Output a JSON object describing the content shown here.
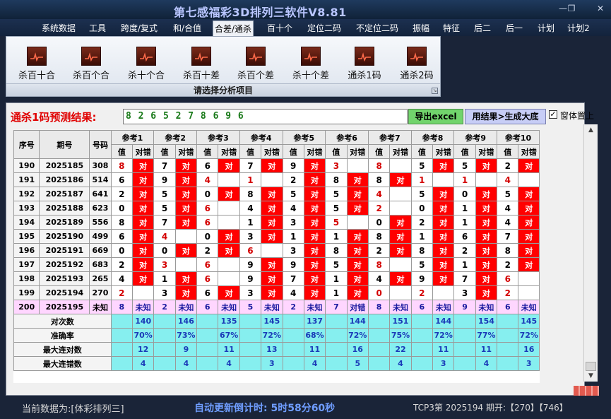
{
  "window": {
    "title": "第七感福彩3D排列三软件V8.81",
    "min": "—",
    "max": "❐",
    "close": "✕"
  },
  "menu": [
    "系统数据",
    "工具",
    "跨度/复式",
    "和/合值",
    "合差/通杀",
    "百十个",
    "定位二码",
    "不定位二码",
    "振幅",
    "特征",
    "后二",
    "后一",
    "计划",
    "计划2"
  ],
  "menu_active_index": 4,
  "ribbon": {
    "buttons": [
      "杀百十合",
      "杀百个合",
      "杀十个合",
      "杀百十差",
      "杀百个差",
      "杀十个差",
      "通杀1码",
      "通杀2码"
    ],
    "caption": "请选择分析项目",
    "launcher": "↘"
  },
  "prediction": {
    "label": "通杀1码预测结果:",
    "numbers": "8 2 6 5 2 7 8 6 9 6",
    "export_button": "导出excel",
    "generate_button": "用结果>生成大底",
    "checkbox_checked": true,
    "checkbox_label": "窗体置上"
  },
  "grid": {
    "fixed_headers": [
      "序号",
      "期号",
      "号码"
    ],
    "ref_headers": [
      "参考1",
      "参考2",
      "参考3",
      "参考4",
      "参考5",
      "参考6",
      "参考7",
      "参考8",
      "参考9",
      "参考10"
    ],
    "sub_headers": [
      "值",
      "对错"
    ],
    "right_mark": "对",
    "rows": [
      {
        "seq": "190",
        "period": "2025185",
        "number": "308",
        "refs": [
          [
            "8",
            1,
            1
          ],
          [
            "7",
            0,
            1
          ],
          [
            "6",
            0,
            1
          ],
          [
            "7",
            0,
            1
          ],
          [
            "9",
            0,
            1
          ],
          [
            "3",
            1,
            0
          ],
          [
            "8",
            1,
            0
          ],
          [
            "5",
            0,
            1
          ],
          [
            "5",
            0,
            1
          ],
          [
            "2",
            0,
            1
          ]
        ]
      },
      {
        "seq": "191",
        "period": "2025186",
        "number": "514",
        "refs": [
          [
            "6",
            0,
            1
          ],
          [
            "9",
            0,
            1
          ],
          [
            "4",
            1,
            0
          ],
          [
            "1",
            1,
            0
          ],
          [
            "2",
            0,
            1
          ],
          [
            "8",
            0,
            1
          ],
          [
            "8",
            0,
            1
          ],
          [
            "1",
            1,
            0
          ],
          [
            "1",
            1,
            0
          ],
          [
            "4",
            1,
            0
          ]
        ]
      },
      {
        "seq": "192",
        "period": "2025187",
        "number": "641",
        "refs": [
          [
            "2",
            0,
            1
          ],
          [
            "5",
            0,
            1
          ],
          [
            "0",
            0,
            1
          ],
          [
            "8",
            0,
            1
          ],
          [
            "5",
            0,
            1
          ],
          [
            "5",
            0,
            1
          ],
          [
            "4",
            1,
            0
          ],
          [
            "5",
            0,
            1
          ],
          [
            "0",
            0,
            1
          ],
          [
            "5",
            0,
            1
          ]
        ]
      },
      {
        "seq": "193",
        "period": "2025188",
        "number": "623",
        "refs": [
          [
            "0",
            0,
            1
          ],
          [
            "5",
            0,
            1
          ],
          [
            "6",
            1,
            0
          ],
          [
            "4",
            0,
            1
          ],
          [
            "4",
            0,
            1
          ],
          [
            "5",
            0,
            1
          ],
          [
            "2",
            1,
            0
          ],
          [
            "0",
            0,
            1
          ],
          [
            "1",
            0,
            1
          ],
          [
            "4",
            0,
            1
          ]
        ]
      },
      {
        "seq": "194",
        "period": "2025189",
        "number": "556",
        "refs": [
          [
            "8",
            0,
            1
          ],
          [
            "7",
            0,
            1
          ],
          [
            "6",
            1,
            0
          ],
          [
            "1",
            0,
            1
          ],
          [
            "3",
            0,
            1
          ],
          [
            "5",
            1,
            0
          ],
          [
            "0",
            0,
            1
          ],
          [
            "2",
            0,
            1
          ],
          [
            "1",
            0,
            1
          ],
          [
            "4",
            0,
            1
          ]
        ]
      },
      {
        "seq": "195",
        "period": "2025190",
        "number": "499",
        "refs": [
          [
            "6",
            0,
            1
          ],
          [
            "4",
            1,
            0
          ],
          [
            "0",
            0,
            1
          ],
          [
            "3",
            0,
            1
          ],
          [
            "1",
            0,
            1
          ],
          [
            "1",
            0,
            1
          ],
          [
            "8",
            0,
            1
          ],
          [
            "1",
            0,
            1
          ],
          [
            "6",
            0,
            1
          ],
          [
            "7",
            0,
            1
          ]
        ]
      },
      {
        "seq": "196",
        "period": "2025191",
        "number": "669",
        "refs": [
          [
            "0",
            0,
            1
          ],
          [
            "0",
            0,
            1
          ],
          [
            "2",
            0,
            1
          ],
          [
            "6",
            1,
            0
          ],
          [
            "3",
            0,
            1
          ],
          [
            "8",
            0,
            1
          ],
          [
            "2",
            0,
            1
          ],
          [
            "8",
            0,
            1
          ],
          [
            "2",
            0,
            1
          ],
          [
            "8",
            0,
            1
          ]
        ]
      },
      {
        "seq": "197",
        "period": "2025192",
        "number": "683",
        "refs": [
          [
            "2",
            0,
            1
          ],
          [
            "3",
            1,
            0
          ],
          [
            "6",
            1,
            0
          ],
          [
            "9",
            0,
            1
          ],
          [
            "9",
            0,
            1
          ],
          [
            "5",
            0,
            1
          ],
          [
            "8",
            1,
            0
          ],
          [
            "5",
            0,
            1
          ],
          [
            "1",
            0,
            1
          ],
          [
            "2",
            0,
            1
          ]
        ]
      },
      {
        "seq": "198",
        "period": "2025193",
        "number": "265",
        "refs": [
          [
            "4",
            0,
            1
          ],
          [
            "1",
            0,
            1
          ],
          [
            "6",
            1,
            0
          ],
          [
            "9",
            0,
            1
          ],
          [
            "7",
            0,
            1
          ],
          [
            "1",
            0,
            1
          ],
          [
            "4",
            0,
            1
          ],
          [
            "9",
            0,
            1
          ],
          [
            "7",
            0,
            1
          ],
          [
            "6",
            1,
            0
          ]
        ]
      },
      {
        "seq": "199",
        "period": "2025194",
        "number": "270",
        "refs": [
          [
            "2",
            1,
            0
          ],
          [
            "3",
            0,
            1
          ],
          [
            "6",
            0,
            1
          ],
          [
            "3",
            0,
            1
          ],
          [
            "4",
            0,
            1
          ],
          [
            "1",
            0,
            1
          ],
          [
            "0",
            1,
            0
          ],
          [
            "2",
            1,
            0
          ],
          [
            "3",
            0,
            1
          ],
          [
            "2",
            1,
            0
          ]
        ]
      }
    ],
    "pending": {
      "seq": "200",
      "period": "2025195",
      "number": "未知",
      "refs": [
        [
          "8",
          "未知"
        ],
        [
          "2",
          "未知"
        ],
        [
          "6",
          "未知"
        ],
        [
          "5",
          "未知"
        ],
        [
          "2",
          "未知"
        ],
        [
          "7",
          "对错"
        ],
        [
          "8",
          "未知"
        ],
        [
          "6",
          "未知"
        ],
        [
          "9",
          "未知"
        ],
        [
          "6",
          "未知"
        ]
      ]
    },
    "stats": [
      {
        "label": "对次数",
        "values": [
          "140",
          "146",
          "135",
          "145",
          "137",
          "144",
          "151",
          "144",
          "154",
          "145"
        ]
      },
      {
        "label": "准确率",
        "values": [
          "70%",
          "73%",
          "67%",
          "72%",
          "68%",
          "72%",
          "75%",
          "72%",
          "77%",
          "72%"
        ]
      },
      {
        "label": "最大连对数",
        "values": [
          "12",
          "9",
          "11",
          "13",
          "11",
          "16",
          "22",
          "11",
          "11",
          "16"
        ]
      },
      {
        "label": "最大连错数",
        "values": [
          "4",
          "4",
          "4",
          "3",
          "4",
          "5",
          "4",
          "3",
          "4",
          "3"
        ]
      }
    ]
  },
  "status": {
    "data_label": "当前数据为:[体彩排列三]",
    "countdown": "自动更新倒计时: 5时58分60秒",
    "issue": "TCP3第 2025194 期开:【270】【746】"
  }
}
